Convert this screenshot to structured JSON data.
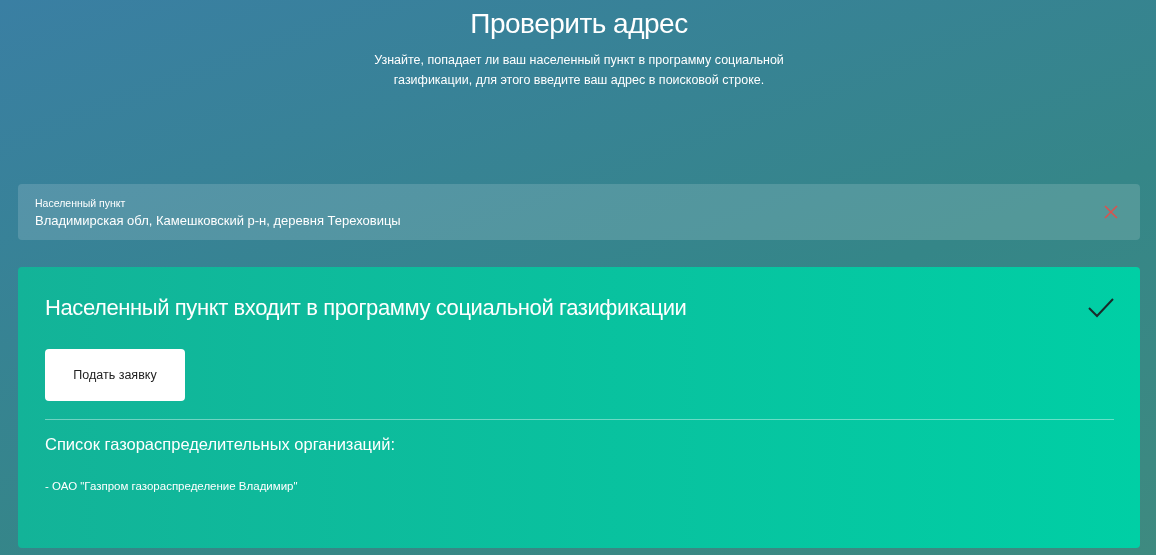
{
  "header": {
    "title": "Проверить адрес",
    "description": "Узнайте, попадает ли ваш населенный пункт в программу социальной газификации, для этого введите ваш адрес в поисковой строке."
  },
  "address_field": {
    "label": "Населенный пункт",
    "value": "Владимирская обл, Камешковский р-н, деревня Тереховицы"
  },
  "result": {
    "included": true,
    "message": "Населенный пункт входит в программу социальной газификации",
    "button": "Подать заявку",
    "list_title": "Список газораспределительных организаций:",
    "organizations": [
      "- ОАО \"Газпром газораспределение Владимир\""
    ]
  }
}
